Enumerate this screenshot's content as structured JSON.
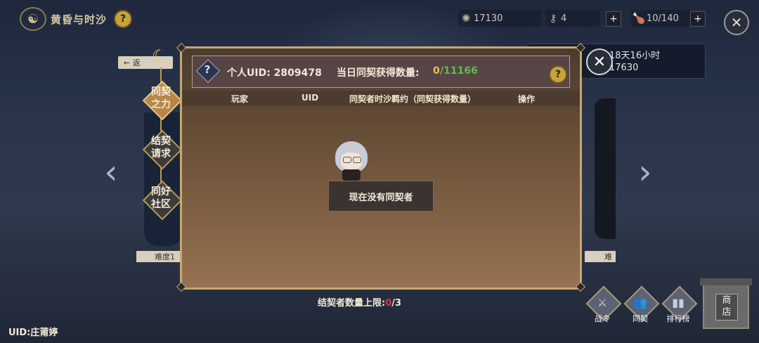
{
  "header": {
    "logo_icon": "fox-emblem-icon",
    "title": "黄昏与时沙",
    "help": "?"
  },
  "resources": [
    {
      "icon": "sand-coin-icon",
      "value": "17130"
    },
    {
      "icon": "key-icon",
      "value": "4"
    },
    {
      "icon": "drumstick-icon",
      "value": "10/140"
    }
  ],
  "plus": "+",
  "close": "✕",
  "info_box": {
    "line1": "18天16小时",
    "line2": "17630"
  },
  "back_label": "返",
  "tabs": [
    {
      "label": "同契\n之力",
      "active": true
    },
    {
      "label": "结契\n请求",
      "active": false
    },
    {
      "label": "同好\n社区",
      "active": false
    }
  ],
  "difficulty": {
    "left": "难度1",
    "right": "难"
  },
  "dialog": {
    "uid_label": "个人UID: 2809478",
    "daily_label": "当日同契获得数量:",
    "daily_current": "0",
    "daily_max": "/11166",
    "help": "?",
    "columns": [
      "玩家",
      "UID",
      "同契者时沙羁约（同契获得数量）",
      "操作"
    ],
    "empty_message": "现在没有同契者"
  },
  "limit": {
    "prefix": "结契者数量上限:",
    "current": "0",
    "suffix": "/3"
  },
  "bottom_uid": "UID:庄莆婷",
  "bottom_buttons": [
    {
      "icon": "battle-pass-icon",
      "label": "战令"
    },
    {
      "icon": "companions-icon",
      "label": "同契"
    },
    {
      "icon": "ranking-icon",
      "label": "排行榜"
    }
  ],
  "shop_label": "商\n店",
  "colors": {
    "accent_gold": "#c8a870",
    "highlight_yellow": "#e6c255",
    "green": "#56c24a",
    "red": "#d83a3a"
  }
}
